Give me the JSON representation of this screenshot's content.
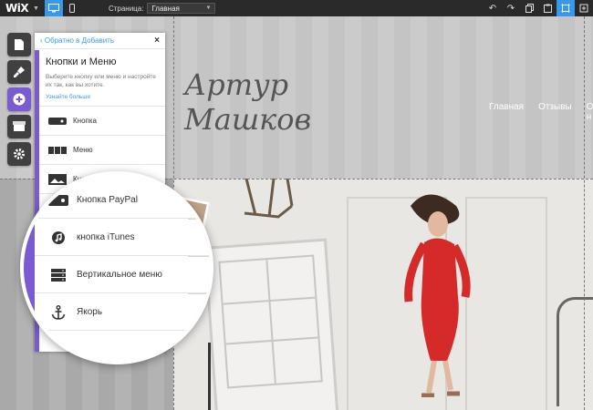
{
  "topbar": {
    "logo": "WiX",
    "page_label": "Страница:",
    "page_select_value": "Главная"
  },
  "site": {
    "title_line1": "Артур",
    "title_line2": "Машков",
    "nav": [
      "Главная",
      "Отзывы",
      "О н"
    ]
  },
  "panel": {
    "back_label": "Обратно в Добавить",
    "close_label": "×",
    "title": "Кнопки и Меню",
    "description": "Выберите кнопку или меню и настройте их так, как вы хотите.",
    "learn_more": "Узнайте больше",
    "items": [
      {
        "label": "Кнопка",
        "icon": "button-icon"
      },
      {
        "label": "Меню",
        "icon": "menu-icon"
      },
      {
        "label": "Кнопка с Фото",
        "icon": "photo-button-icon"
      }
    ]
  },
  "magnifier": {
    "items": [
      {
        "label": "Кнопка PayPal",
        "icon": "paypal-icon"
      },
      {
        "label": "кнопка iTunes",
        "icon": "itunes-icon"
      },
      {
        "label": "Вертикальное меню",
        "icon": "vertical-menu-icon"
      },
      {
        "label": "Якорь",
        "icon": "anchor-icon"
      }
    ]
  },
  "colors": {
    "accent_purple": "#7a5bd1",
    "accent_blue": "#3899ec",
    "topbar_bg": "#2a2a2a",
    "dress_red": "#d42a2a"
  }
}
